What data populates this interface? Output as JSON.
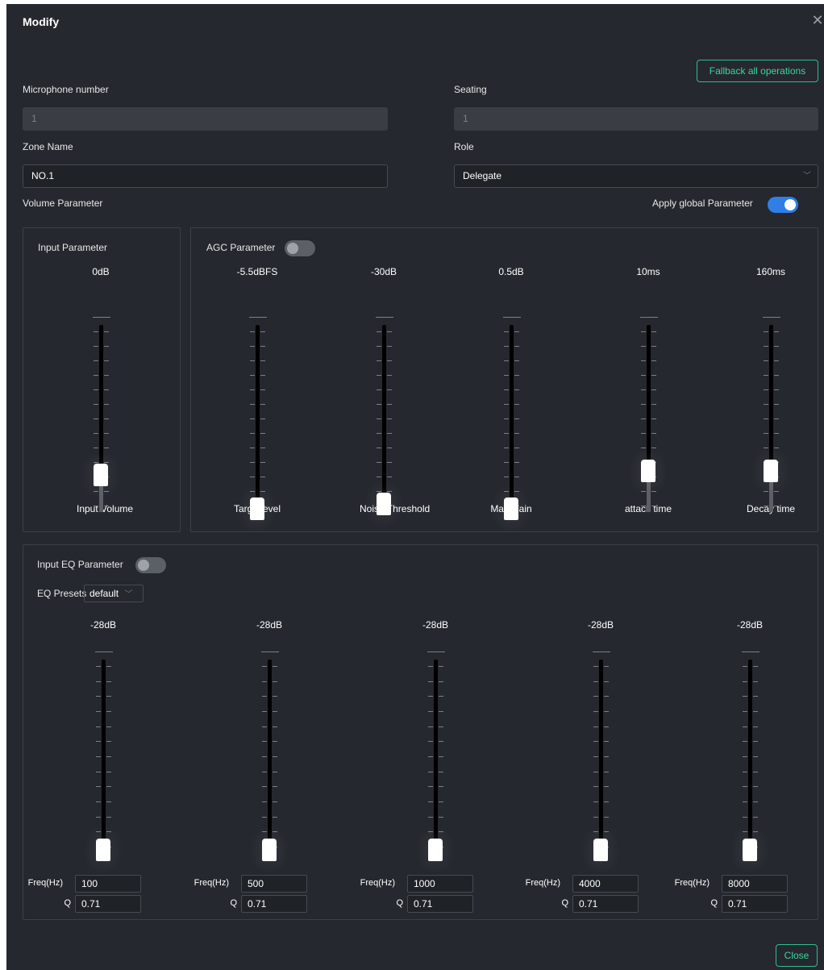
{
  "dialog": {
    "title": "Modify",
    "fallback_label": "Fallback all operations",
    "close_label": "Close"
  },
  "form": {
    "microphone_label": "Microphone number",
    "microphone_value": "1",
    "seating_label": "Seating",
    "seating_value": "1",
    "zone_label": "Zone Name",
    "zone_value": "NO.1",
    "role_label": "Role",
    "role_value": "Delegate"
  },
  "volume": {
    "title": "Volume Parameter",
    "apply_global_label": "Apply global Parameter",
    "apply_global_on": true
  },
  "input_param": {
    "title": "Input Parameter",
    "value": "0dB",
    "name": "Input Volume",
    "level": 0.2
  },
  "agc": {
    "title": "AGC Parameter",
    "enabled": false,
    "sliders": [
      {
        "value": "-5.5dBFS",
        "name": "Targetlevel",
        "level": 0.0
      },
      {
        "value": "-30dB",
        "name": "Noise Threshold",
        "level": 0.03
      },
      {
        "value": "0.5dB",
        "name": "Max Gain",
        "level": 0.0
      },
      {
        "value": "10ms",
        "name": "attack time",
        "level": 0.22
      },
      {
        "value": "160ms",
        "name": "Decay time",
        "level": 0.22
      }
    ]
  },
  "eq": {
    "title": "Input EQ Parameter",
    "enabled": false,
    "presets_label": "EQ Presets",
    "presets_value": "default",
    "freq_label": "Freq(Hz)",
    "q_label": "Q",
    "bands": [
      {
        "value": "-28dB",
        "freq": "100",
        "q": "0.71"
      },
      {
        "value": "-28dB",
        "freq": "500",
        "q": "0.71"
      },
      {
        "value": "-28dB",
        "freq": "1000",
        "q": "0.71"
      },
      {
        "value": "-28dB",
        "freq": "4000",
        "q": "0.71"
      },
      {
        "value": "-28dB",
        "freq": "8000",
        "q": "0.71"
      }
    ]
  }
}
